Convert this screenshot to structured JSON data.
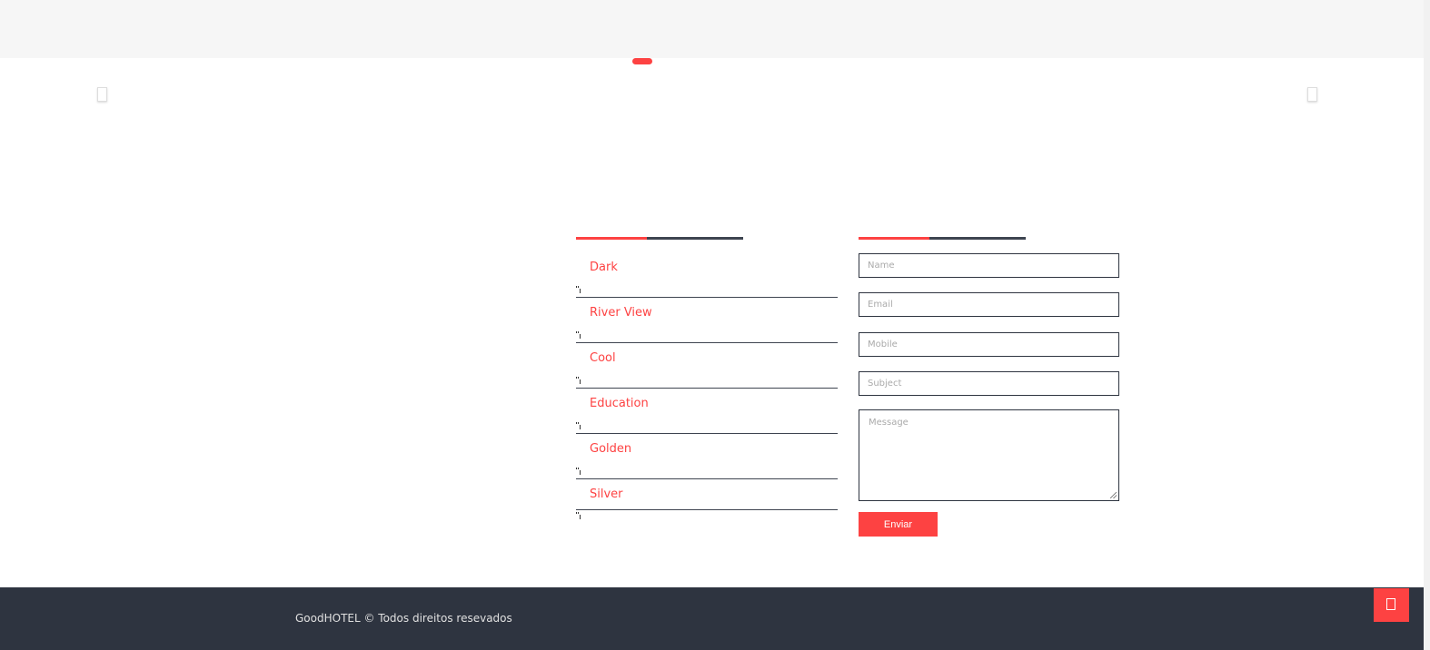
{
  "colors": {
    "accent": "#fd4242",
    "dark": "#2e3440"
  },
  "slider": {
    "prev_icon": "chevron-left-icon",
    "next_icon": "chevron-right-icon"
  },
  "rooms": {
    "items": [
      {
        "label": "Dark"
      },
      {
        "label": "River View"
      },
      {
        "label": "Cool"
      },
      {
        "label": "Education"
      },
      {
        "label": "Golden"
      },
      {
        "label": "Silver"
      }
    ]
  },
  "form": {
    "name_placeholder": "Name",
    "email_placeholder": "Email",
    "mobile_placeholder": "Mobile",
    "subject_placeholder": "Subject",
    "message_placeholder": "Message",
    "submit_label": "Enviar"
  },
  "footer": {
    "copyright": "GoodHOTEL © Todos direitos resevados",
    "back_to_top_icon": "arrow-up-icon"
  }
}
